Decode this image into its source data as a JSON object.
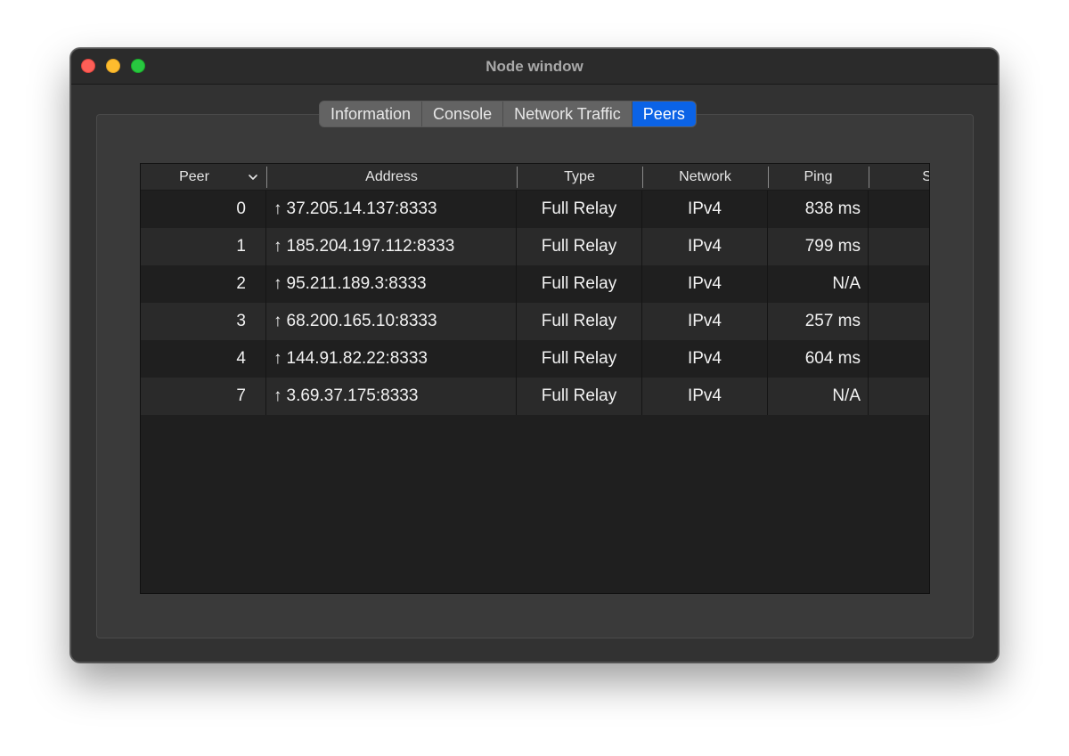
{
  "window": {
    "title": "Node window"
  },
  "tabs": [
    {
      "label": "Information",
      "active": false
    },
    {
      "label": "Console",
      "active": false
    },
    {
      "label": "Network Traffic",
      "active": false
    },
    {
      "label": "Peers",
      "active": true
    }
  ],
  "table": {
    "columns": [
      "Peer",
      "Address",
      "Type",
      "Network",
      "Ping",
      "Se"
    ],
    "sort_indicator": "chevron-down-icon",
    "direction_glyph": "↑",
    "rows": [
      {
        "peer": "0",
        "address": "37.205.14.137:8333",
        "type": "Full Relay",
        "network": "IPv4",
        "ping": "838 ms"
      },
      {
        "peer": "1",
        "address": "185.204.197.112:8333",
        "type": "Full Relay",
        "network": "IPv4",
        "ping": "799 ms"
      },
      {
        "peer": "2",
        "address": "95.211.189.3:8333",
        "type": "Full Relay",
        "network": "IPv4",
        "ping": "N/A"
      },
      {
        "peer": "3",
        "address": "68.200.165.10:8333",
        "type": "Full Relay",
        "network": "IPv4",
        "ping": "257 ms"
      },
      {
        "peer": "4",
        "address": "144.91.82.22:8333",
        "type": "Full Relay",
        "network": "IPv4",
        "ping": "604 ms"
      },
      {
        "peer": "7",
        "address": "3.69.37.175:8333",
        "type": "Full Relay",
        "network": "IPv4",
        "ping": "N/A"
      }
    ]
  },
  "colors": {
    "accent": "#0b63e6",
    "close": "#fe5f57",
    "minimize": "#febc2e",
    "zoom": "#28c840"
  }
}
